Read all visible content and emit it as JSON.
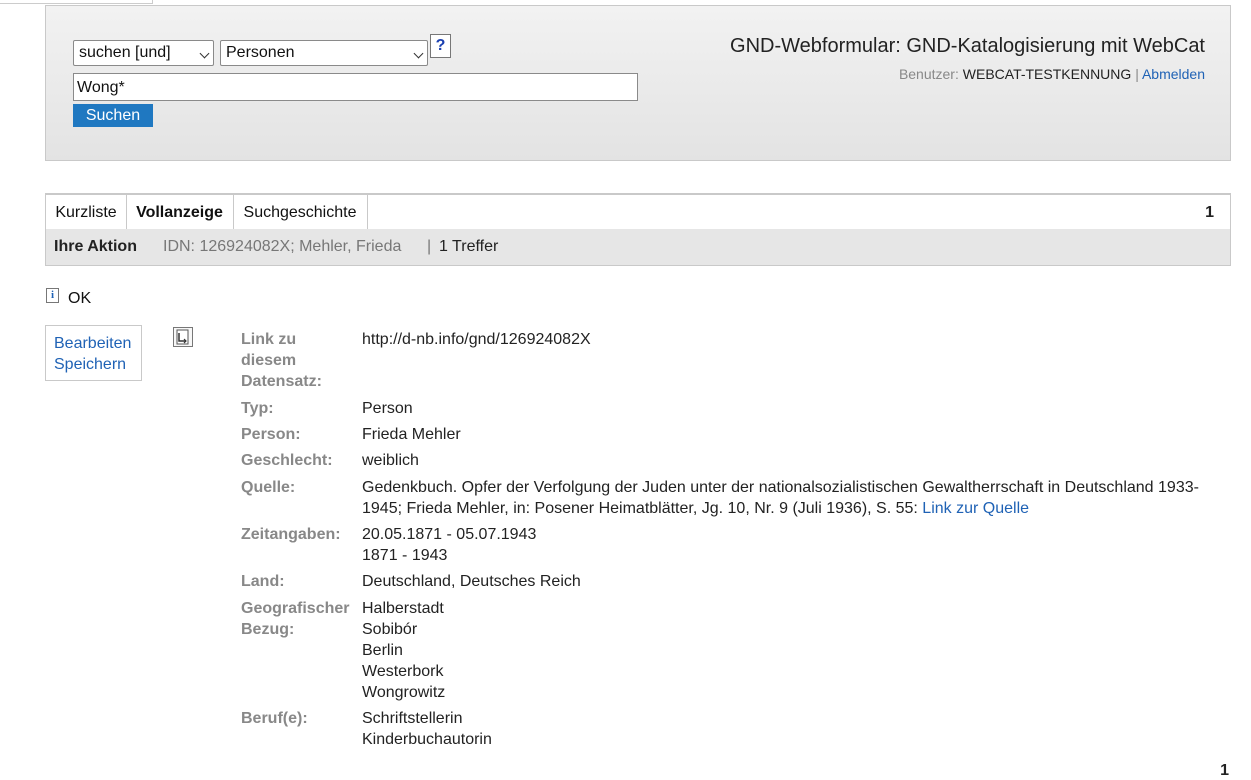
{
  "search": {
    "operator": "suchen [und]",
    "index": "Personen",
    "help_label": "?",
    "query": "Wong*",
    "submit_label": "Suchen"
  },
  "header": {
    "title": "GND-Webformular: GND-Katalogisierung mit WebCat",
    "user_prefix": "Benutzer:",
    "user_name": "WEBCAT-TESTKENNUNG",
    "separator": "|",
    "logout_label": "Abmelden"
  },
  "tabs": [
    {
      "label": "Kurzliste"
    },
    {
      "label": "Vollanzeige"
    },
    {
      "label": "Suchgeschichte"
    }
  ],
  "page_number": "1",
  "action_bar": {
    "label": "Ihre Aktion",
    "idn": "IDN: 126924082X; Mehler, Frieda",
    "separator": "|",
    "hits": "1 Treffer"
  },
  "status": {
    "icon": "info-icon",
    "text": "OK"
  },
  "record_actions": {
    "edit_label": "Bearbeiten",
    "save_label": "Speichern"
  },
  "record": {
    "link_label": "Link zu diesem Datensatz:",
    "link_value": "http://d-nb.info/gnd/126924082X",
    "type_label": "Typ:",
    "type_value": "Person",
    "person_label": "Person:",
    "person_value": "Frieda Mehler",
    "gender_label": "Geschlecht:",
    "gender_value": "weiblich",
    "source_label": "Quelle:",
    "source_value": "Gedenkbuch. Opfer der Verfolgung der Juden unter der nationalsozialistischen Gewaltherrschaft in Deutschland 1933-1945; Frieda Mehler, in: Posener Heimatblätter, Jg. 10, Nr. 9 (Juli 1936), S. 55:",
    "source_link_label": "Link zur Quelle",
    "dates_label": "Zeitangaben:",
    "dates_values": [
      "20.05.1871 - 05.07.1943",
      "1871 - 1943"
    ],
    "country_label": "Land:",
    "country_value": "Deutschland, Deutsches Reich",
    "geo_label_line1": "Geografischer",
    "geo_label_line2": "Bezug:",
    "geo_values": [
      "Halberstadt",
      "Sobibór",
      "Berlin",
      "Westerbork",
      "Wongrowitz"
    ],
    "occupation_label": "Beruf(e):",
    "occupation_values": [
      "Schriftstellerin",
      "Kinderbuchautorin"
    ]
  },
  "bottom_page_number": "1"
}
